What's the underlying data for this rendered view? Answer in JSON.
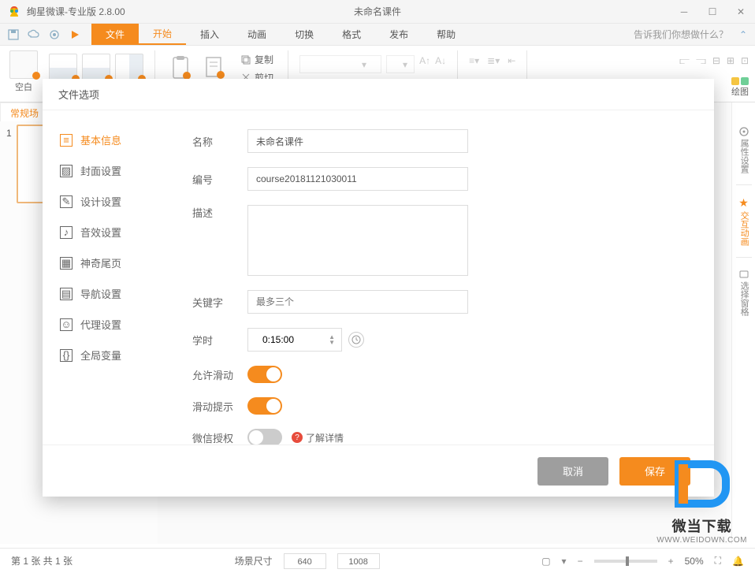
{
  "titlebar": {
    "app_title": "绚星微课-专业版 2.8.00",
    "doc_title": "未命名课件"
  },
  "tabs": {
    "file": "文件",
    "start": "开始",
    "insert": "插入",
    "anim": "动画",
    "switch": "切换",
    "format": "格式",
    "publish": "发布",
    "help": "帮助",
    "tell_me": "告诉我们你想做什么？"
  },
  "ribbon": {
    "blank": "空白",
    "copy": "复制",
    "cut": "剪切",
    "drawing": "绘图"
  },
  "left": {
    "scene_tab": "常规场",
    "thumb_num": "1"
  },
  "side": {
    "props": "属性设置",
    "anim": "交互动画",
    "panel": "选择窗格"
  },
  "modal": {
    "title": "文件选项",
    "sidebar": {
      "basic": "基本信息",
      "cover": "封面设置",
      "design": "设计设置",
      "sound": "音效设置",
      "tail": "神奇尾页",
      "nav": "导航设置",
      "proxy": "代理设置",
      "global": "全局变量"
    },
    "form": {
      "name_label": "名称",
      "name_value": "未命名课件",
      "id_label": "编号",
      "id_value": "course20181121030011",
      "desc_label": "描述",
      "keyword_label": "关键字",
      "keyword_placeholder": "最多三个",
      "duration_label": "学时",
      "duration_value": "0:15:00",
      "allow_slide_label": "允许滑动",
      "slide_hint_label": "滑动提示",
      "wechat_label": "微信授权",
      "learn_more": "了解详情"
    },
    "footer": {
      "cancel": "取消",
      "save": "保存"
    }
  },
  "status": {
    "page": "第 1 张  共 1 张",
    "scene_size": "场景尺寸",
    "w": "640",
    "h": "1008",
    "zoom": "50%"
  },
  "watermark": {
    "text": "微当下载",
    "url": "WWW.WEIDOWN.COM"
  }
}
